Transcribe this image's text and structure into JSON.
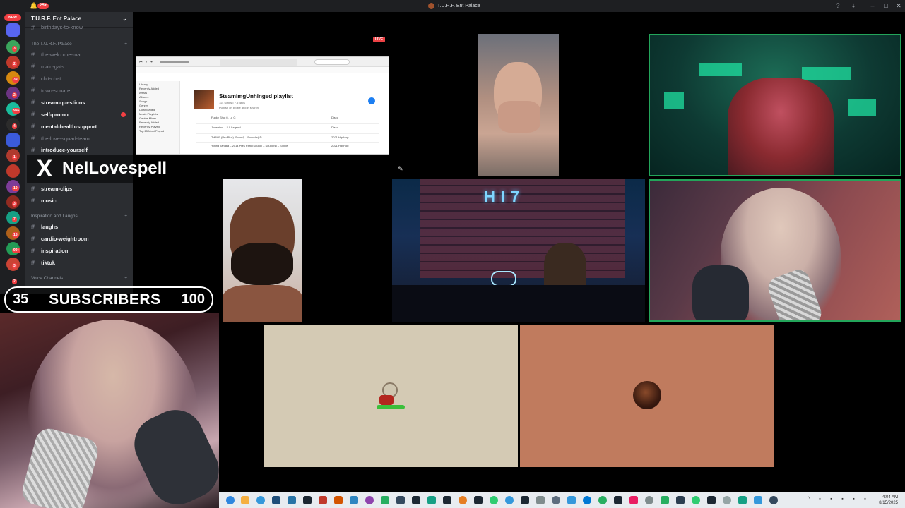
{
  "titlebar": {
    "notification_count": "25+",
    "title": "T.U.R.F. Ent Palace",
    "icons": {
      "help": "?",
      "download": "⤓",
      "minimize": "–",
      "maximize": "□",
      "close": "✕"
    }
  },
  "server_rail": {
    "new_label": "NEW",
    "badges": [
      "3",
      "2",
      "39",
      "2",
      "99+",
      "4",
      "1",
      "10",
      "3",
      "7",
      "15",
      "99+",
      "3",
      "2"
    ]
  },
  "sidebar": {
    "server_name": "T.U.R.F. Ent Palace",
    "scrolled_channel": "birthdays-to-know",
    "categories": {
      "palace": "The T.U.R.F. Palace",
      "inspiration": "Inspiration and Laughs",
      "voice": "Voice Channels"
    },
    "channels": [
      {
        "name": "the-welcome-mat",
        "bold": false
      },
      {
        "name": "main-gats",
        "bold": false
      },
      {
        "name": "chit-chat",
        "bold": false
      },
      {
        "name": "town-square",
        "bold": false
      },
      {
        "name": "stream-questions",
        "bold": true
      },
      {
        "name": "self-promo",
        "bold": true
      },
      {
        "name": "mental-health-support",
        "bold": true
      },
      {
        "name": "the-love-squad-team",
        "bold": false
      },
      {
        "name": "introduce-yourself",
        "bold": true
      },
      {
        "name": "stream-clips",
        "bold": true
      },
      {
        "name": "music",
        "bold": true
      },
      {
        "name": "laughs",
        "bold": true
      },
      {
        "name": "cardio-weightroom",
        "bold": true
      },
      {
        "name": "inspiration",
        "bold": true
      },
      {
        "name": "tiktok",
        "bold": true
      }
    ]
  },
  "overlay": {
    "x_logo": "X",
    "handle": "NelLovespell",
    "sub_current": "35",
    "sub_label": "SUBSCRIBERS",
    "sub_goal": "100"
  },
  "screen_share": {
    "live_label": "LIVE",
    "playlist_title": "SteamimgUnhinged playlist",
    "playlist_meta": "114 songs • 7.5 days",
    "playlist_note": "Publish on profile and in search",
    "sidebar_heading": "Library",
    "sidebar_items": [
      "Recently Added",
      "Artists",
      "Albums",
      "Songs",
      "Genres",
      "Downloaded"
    ],
    "playlists_heading": "Music Playlists",
    "playlist_items": [
      "Genius Mixes",
      "Recently Added",
      "Recently Played",
      "Top 25 Most Played"
    ],
    "rows": [
      {
        "title": "Funky Shot ft. Lu G",
        "extra": "Disco"
      },
      {
        "title": "Juventino – 2.0 Legend",
        "extra": "Disco"
      },
      {
        "title": "TWINE (Pro Plus) [Sound] – Sound(s) ®",
        "extra": "2021   Hip Hop"
      },
      {
        "title": "Young Tanaka – 2014 Pres Park [Sound] – Sound(s) – Single",
        "extra": "2021   Hip Hop"
      }
    ]
  },
  "tiles": {
    "studio_sign": "HI7"
  },
  "taskbar": {
    "clock_time": "4:04 AM",
    "clock_date": "8/15/2025"
  }
}
